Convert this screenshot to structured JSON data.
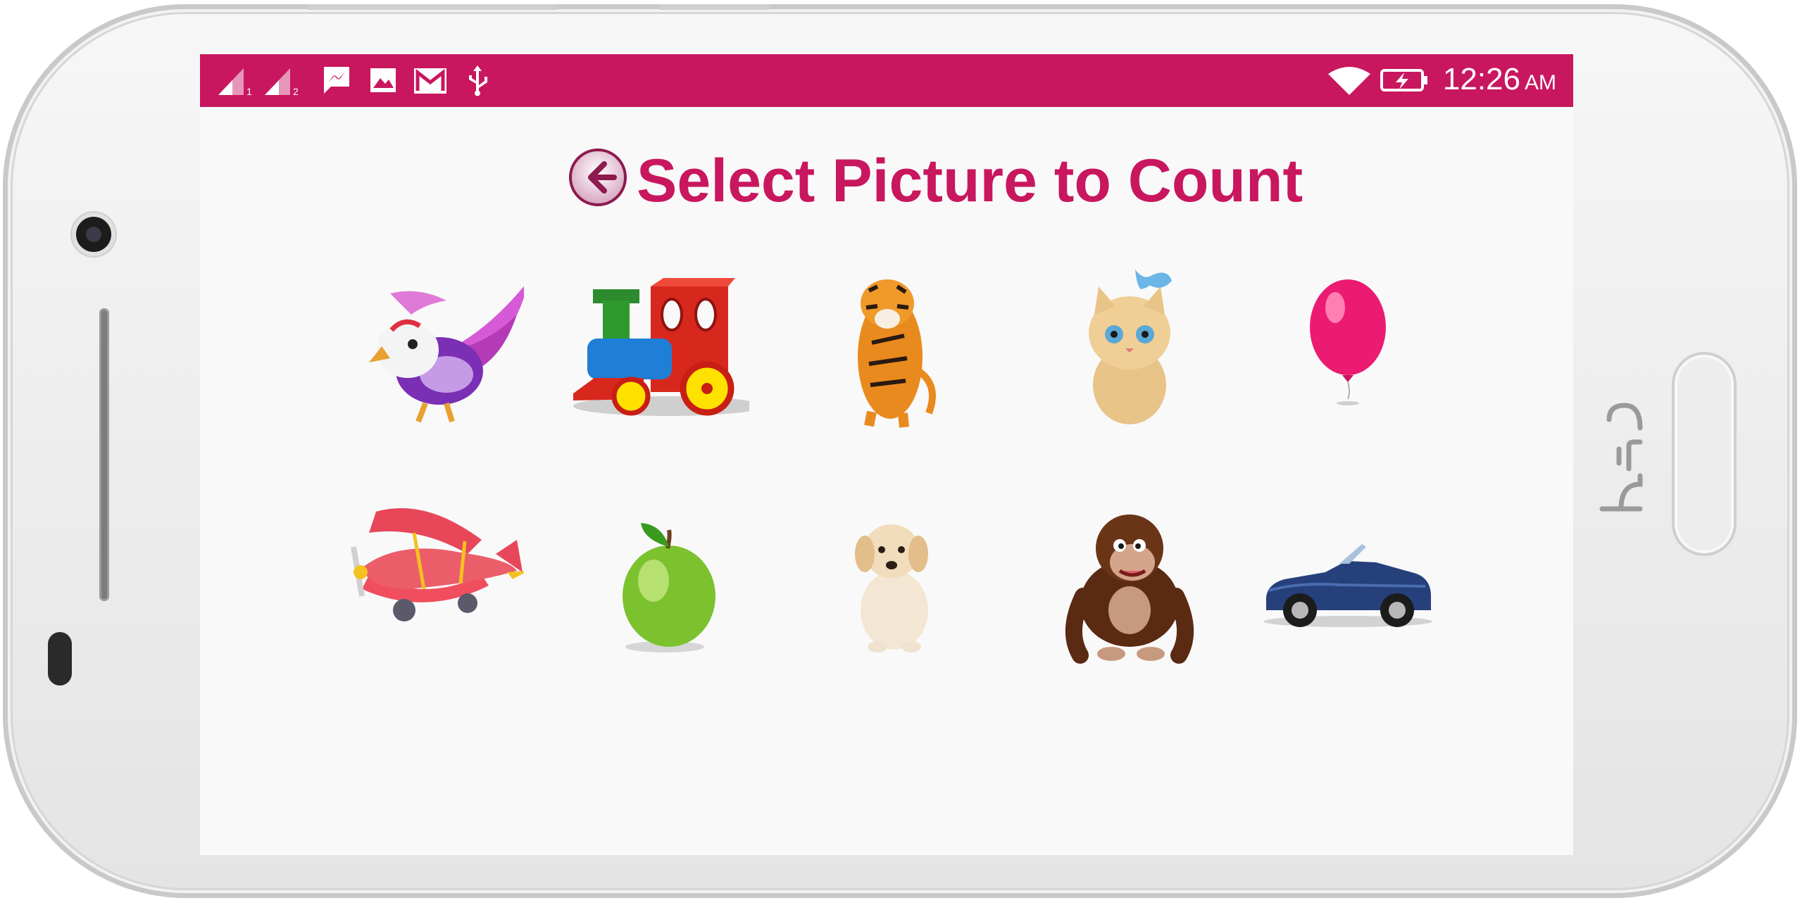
{
  "device": {
    "brand": "htc"
  },
  "status_bar": {
    "time": "12:26",
    "ampm": "AM",
    "sim1": "1",
    "sim2": "2",
    "icons": [
      "signal-sim1-icon",
      "signal-sim2-icon",
      "messenger-icon",
      "gallery-icon",
      "gmail-icon",
      "usb-icon",
      "wifi-icon",
      "battery-charging-icon"
    ],
    "color": "#c8175f"
  },
  "header": {
    "title": "Select Picture to Count",
    "back_icon": "back-arrow-icon"
  },
  "pictures": [
    {
      "name": "bird"
    },
    {
      "name": "train"
    },
    {
      "name": "tiger"
    },
    {
      "name": "kitten"
    },
    {
      "name": "balloon"
    },
    {
      "name": "airplane"
    },
    {
      "name": "apple"
    },
    {
      "name": "puppy"
    },
    {
      "name": "gorilla"
    },
    {
      "name": "car"
    }
  ]
}
